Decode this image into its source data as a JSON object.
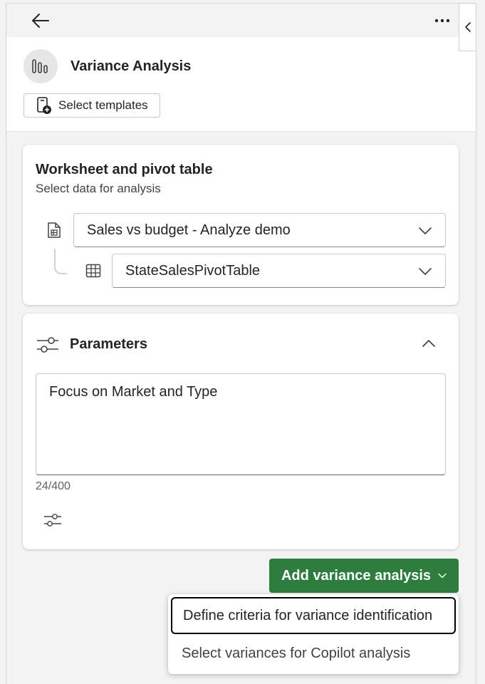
{
  "header": {
    "title": "Variance Analysis",
    "templates_label": "Select templates"
  },
  "worksheet_card": {
    "title": "Worksheet and pivot table",
    "subtitle": "Select data for analysis",
    "worksheet_value": "Sales vs budget - Analyze demo",
    "pivot_value": "StateSalesPivotTable"
  },
  "parameters_card": {
    "title": "Parameters",
    "text_value": "Focus on Market and Type",
    "counter": "24/400"
  },
  "actions": {
    "primary_label": "Add variance analysis"
  },
  "menu": {
    "items": [
      {
        "label": "Define criteria for variance identification"
      },
      {
        "label": "Select variances for Copilot analysis"
      }
    ]
  },
  "colors": {
    "primary": "#2e7d3e",
    "background": "#f3f3f3"
  }
}
